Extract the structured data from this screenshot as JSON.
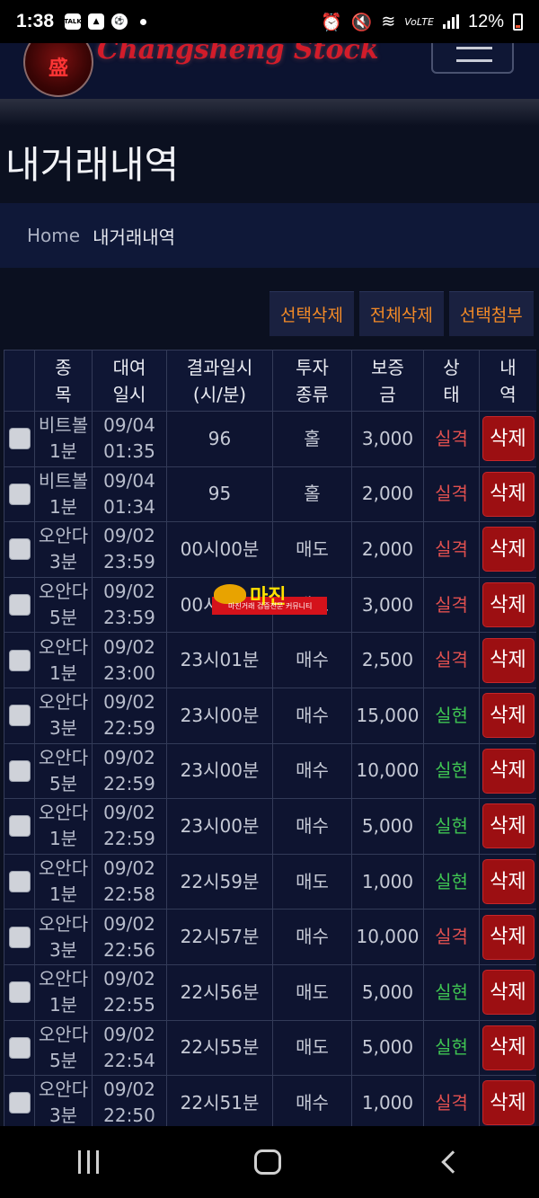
{
  "status_bar": {
    "time": "1:38",
    "battery": "12%",
    "notification_icons": [
      "talk-icon",
      "image-icon",
      "soccer-icon",
      "dot"
    ],
    "system_icons": [
      "alarm-icon",
      "mute-icon",
      "wifi-icon",
      "volte-icon",
      "signal-icon",
      "battery-icon"
    ],
    "talk_label": "TALK",
    "volte_label": "VoLTE"
  },
  "header": {
    "logo_char": "盛",
    "logo_text": "Changsheng Stock"
  },
  "page_title": "내거래내역",
  "breadcrumb": {
    "home": "Home",
    "current": "내거래내역"
  },
  "actions": {
    "select_delete": "선택삭제",
    "delete_all": "전체삭제",
    "select_attach": "선택첨부"
  },
  "table": {
    "columns": [
      "",
      "종\n목",
      "대여\n일시",
      "결과일시\n(시/분)",
      "투자\n종류",
      "보증\n금",
      "상\n태",
      "내\n역"
    ],
    "delete_label": "삭제",
    "rows": [
      {
        "name": "비트볼\n1분",
        "date": "09/04\n01:35",
        "result": "96",
        "type": "홀",
        "amount": "3,000",
        "status": "실격",
        "win": false
      },
      {
        "name": "비트볼\n1분",
        "date": "09/04\n01:34",
        "result": "95",
        "type": "홀",
        "amount": "2,000",
        "status": "실격",
        "win": false
      },
      {
        "name": "오안다\n3분",
        "date": "09/02\n23:59",
        "result": "00시00분",
        "type": "매도",
        "amount": "2,000",
        "status": "실격",
        "win": false
      },
      {
        "name": "오안다\n5분",
        "date": "09/02\n23:59",
        "result": "00시00분",
        "type": "매도",
        "amount": "3,000",
        "status": "실격",
        "win": false
      },
      {
        "name": "오안다\n1분",
        "date": "09/02\n23:00",
        "result": "23시01분",
        "type": "매수",
        "amount": "2,500",
        "status": "실격",
        "win": false
      },
      {
        "name": "오안다\n3분",
        "date": "09/02\n22:59",
        "result": "23시00분",
        "type": "매수",
        "amount": "15,000",
        "status": "실현",
        "win": true
      },
      {
        "name": "오안다\n5분",
        "date": "09/02\n22:59",
        "result": "23시00분",
        "type": "매수",
        "amount": "10,000",
        "status": "실현",
        "win": true
      },
      {
        "name": "오안다\n1분",
        "date": "09/02\n22:59",
        "result": "23시00분",
        "type": "매수",
        "amount": "5,000",
        "status": "실현",
        "win": true
      },
      {
        "name": "오안다\n1분",
        "date": "09/02\n22:58",
        "result": "22시59분",
        "type": "매도",
        "amount": "1,000",
        "status": "실현",
        "win": true
      },
      {
        "name": "오안다\n3분",
        "date": "09/02\n22:56",
        "result": "22시57분",
        "type": "매수",
        "amount": "10,000",
        "status": "실격",
        "win": false
      },
      {
        "name": "오안다\n1분",
        "date": "09/02\n22:55",
        "result": "22시56분",
        "type": "매도",
        "amount": "5,000",
        "status": "실현",
        "win": true
      },
      {
        "name": "오안다\n5분",
        "date": "09/02\n22:54",
        "result": "22시55분",
        "type": "매도",
        "amount": "5,000",
        "status": "실현",
        "win": true
      },
      {
        "name": "오안다\n3분",
        "date": "09/02\n22:50",
        "result": "22시51분",
        "type": "매수",
        "amount": "1,000",
        "status": "실격",
        "win": false
      }
    ]
  },
  "watermark": {
    "text": "마진",
    "sub": "마진거래 검증전문 커뮤니티"
  },
  "colors": {
    "loss": "#e0504f",
    "win": "#3fc452",
    "accent": "#f28a27",
    "delete": "#9c0f12"
  }
}
